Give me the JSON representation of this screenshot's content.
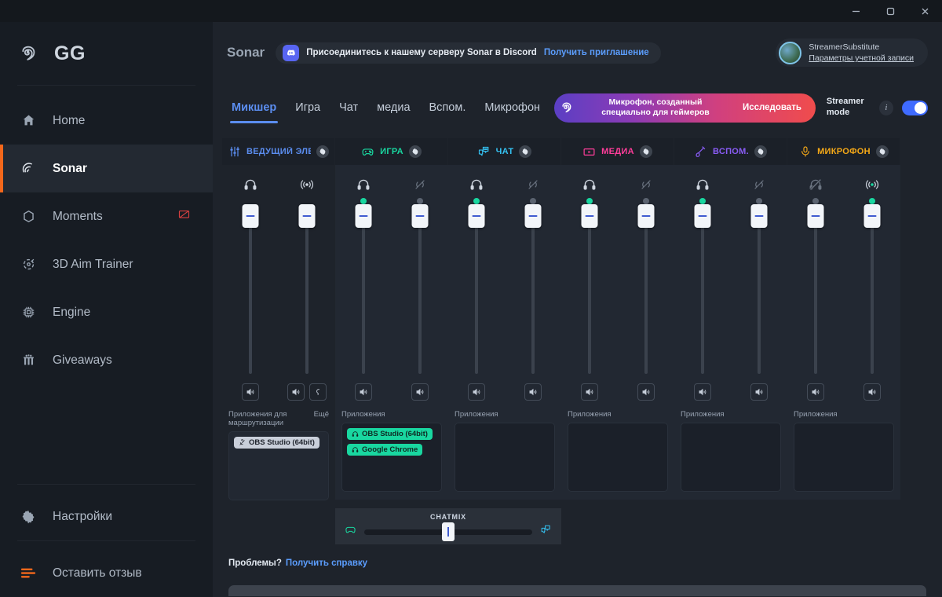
{
  "window": {
    "minimize": "minimize-icon",
    "maximize": "maximize-icon",
    "close": "close-icon"
  },
  "sidebar": {
    "brand": "GG",
    "items": [
      {
        "label": "Home",
        "icon": "home-icon",
        "active": false
      },
      {
        "label": "Sonar",
        "icon": "sonar-icon",
        "active": true
      },
      {
        "label": "Moments",
        "icon": "hexagon-icon",
        "active": false,
        "badge": "monitor-off-icon"
      },
      {
        "label": "3D Aim Trainer",
        "icon": "crosshair-icon",
        "active": false
      },
      {
        "label": "Engine",
        "icon": "chip-icon",
        "active": false
      },
      {
        "label": "Giveaways",
        "icon": "gift-icon",
        "active": false
      }
    ],
    "bottom": [
      {
        "label": "Настройки",
        "icon": "gear-icon"
      },
      {
        "label": "Оставить отзыв",
        "icon": "feedback-icon"
      }
    ]
  },
  "topbar": {
    "title": "Sonar",
    "discord": {
      "icon": "discord-icon",
      "text": "Присоединитесь к нашему серверу Sonar в Discord",
      "link": "Получить приглашение"
    },
    "account": {
      "name": "StreamerSubstitute",
      "link": "Параметры учетной записи",
      "avatar": "avatar"
    }
  },
  "tabs": [
    {
      "label": "Микшер",
      "active": true
    },
    {
      "label": "Игра",
      "active": false
    },
    {
      "label": "Чат",
      "active": false
    },
    {
      "label": "медиа",
      "active": false
    },
    {
      "label": "Вспом.",
      "active": false
    },
    {
      "label": "Микрофон",
      "active": false
    }
  ],
  "promo": {
    "text": "Микрофон, созданный специально для геймеров",
    "cta": "Исследовать",
    "logo": "steelseries-icon"
  },
  "streamer_mode": {
    "label": "Streamer mode",
    "info": "i",
    "enabled": true
  },
  "mixer": {
    "channels": [
      {
        "name": "ВЕДУЩИЙ ЭЛЕМЕНТ",
        "icon": "sliders-icon",
        "color": "#5b8def",
        "gear": "gear-icon",
        "apps_label": "Приложения для маршрутизации",
        "more": "Ещё",
        "faders": [
          {
            "icon": "headphones-icon",
            "status": "on",
            "value": 100,
            "buttons": [
              "speaker-icon"
            ]
          },
          {
            "icon": "stream-icon",
            "status": "none",
            "value": 100,
            "buttons": [
              "speaker-icon",
              "mic-monitor-icon"
            ]
          }
        ],
        "apps": [
          {
            "label": "OBS Studio (64bit)",
            "icon": "mic-off-icon",
            "style": "grey"
          }
        ]
      },
      {
        "name": "ИГРА",
        "icon": "gamepad-icon",
        "color": "#19d7a0",
        "gear": "gear-icon",
        "apps_label": "Приложения",
        "faders": [
          {
            "icon": "headphones-icon",
            "status": "on",
            "value": 100,
            "buttons": [
              "speaker-icon"
            ]
          },
          {
            "icon": "stream-off-icon",
            "status": "off",
            "value": 100,
            "buttons": [
              "speaker-icon"
            ]
          }
        ],
        "apps": [
          {
            "label": "OBS Studio (64bit)",
            "icon": "headphones-icon",
            "style": "green"
          },
          {
            "label": "Google Chrome",
            "icon": "headphones-icon",
            "style": "green"
          }
        ]
      },
      {
        "name": "ЧАТ",
        "icon": "chat-icon",
        "color": "#35c3f3",
        "gear": "gear-icon",
        "apps_label": "Приложения",
        "faders": [
          {
            "icon": "headphones-icon",
            "status": "on",
            "value": 100,
            "buttons": [
              "speaker-icon"
            ]
          },
          {
            "icon": "stream-off-icon",
            "status": "off",
            "value": 100,
            "buttons": [
              "speaker-icon"
            ]
          }
        ],
        "apps": []
      },
      {
        "name": "МЕДИА",
        "icon": "media-icon",
        "color": "#ff3d9a",
        "gear": "gear-icon",
        "apps_label": "Приложения",
        "faders": [
          {
            "icon": "headphones-icon",
            "status": "on",
            "value": 100,
            "buttons": [
              "speaker-icon"
            ]
          },
          {
            "icon": "stream-off-icon",
            "status": "off",
            "value": 100,
            "buttons": [
              "speaker-icon"
            ]
          }
        ],
        "apps": []
      },
      {
        "name": "ВСПОМ.",
        "icon": "aux-icon",
        "color": "#8a5cf6",
        "gear": "gear-icon",
        "apps_label": "Приложения",
        "faders": [
          {
            "icon": "headphones-icon",
            "status": "on",
            "value": 100,
            "buttons": [
              "speaker-icon"
            ]
          },
          {
            "icon": "stream-off-icon",
            "status": "off",
            "value": 100,
            "buttons": [
              "speaker-icon"
            ]
          }
        ],
        "apps": []
      },
      {
        "name": "МИКРОФОН",
        "icon": "microphone-icon",
        "color": "#f6a917",
        "gear": "gear-icon",
        "apps_label": "Приложения",
        "faders": [
          {
            "icon": "headphones-off-icon",
            "status": "off",
            "value": 100,
            "buttons": [
              "speaker-icon"
            ]
          },
          {
            "icon": "stream-icon",
            "status": "on",
            "value": 100,
            "buttons": [
              "speaker-icon"
            ]
          }
        ],
        "apps": []
      }
    ],
    "chatmix": {
      "label": "CHATMIX",
      "left_icon": "gamepad-icon",
      "right_icon": "chat-icon",
      "value": 50
    }
  },
  "footer": {
    "problems": "Проблемы?",
    "help_link": "Получить справку"
  }
}
